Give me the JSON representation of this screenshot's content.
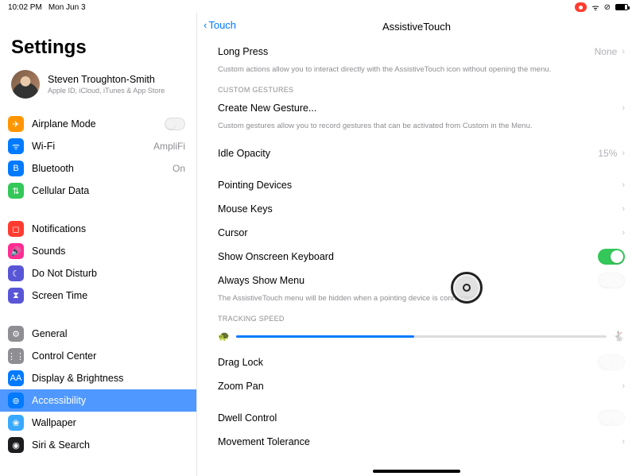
{
  "status": {
    "time": "10:02 PM",
    "date": "Mon Jun 3"
  },
  "sidebar": {
    "title": "Settings",
    "profile": {
      "name": "Steven Troughton-Smith",
      "sub": "Apple ID, iCloud, iTunes & App Store"
    },
    "groups": [
      [
        {
          "icon": "airplane-icon",
          "cls": "i-orange",
          "glyph": "✈",
          "label": "Airplane Mode",
          "trailing": "toggle"
        },
        {
          "icon": "wifi-icon",
          "cls": "i-blue",
          "glyph": "ᯤ",
          "label": "Wi-Fi",
          "trailing_text": "AmpliFi"
        },
        {
          "icon": "bluetooth-icon",
          "cls": "i-blue",
          "glyph": "B",
          "label": "Bluetooth",
          "trailing_text": "On"
        },
        {
          "icon": "cellular-icon",
          "cls": "i-green",
          "glyph": "⇅",
          "label": "Cellular Data"
        }
      ],
      [
        {
          "icon": "bell-icon",
          "cls": "i-red",
          "glyph": "◻",
          "label": "Notifications"
        },
        {
          "icon": "speaker-icon",
          "cls": "i-pink",
          "glyph": "🔊",
          "label": "Sounds"
        },
        {
          "icon": "moon-icon",
          "cls": "i-purple",
          "glyph": "☾",
          "label": "Do Not Disturb"
        },
        {
          "icon": "hourglass-icon",
          "cls": "i-indigo",
          "glyph": "⧗",
          "label": "Screen Time"
        }
      ],
      [
        {
          "icon": "gear-icon",
          "cls": "i-gray",
          "glyph": "⚙",
          "label": "General"
        },
        {
          "icon": "control-center-icon",
          "cls": "i-gray",
          "glyph": "⋮⋮",
          "label": "Control Center"
        },
        {
          "icon": "brightness-icon",
          "cls": "i-blue",
          "glyph": "AA",
          "label": "Display & Brightness"
        },
        {
          "icon": "accessibility-icon",
          "cls": "i-blue",
          "glyph": "⊚",
          "label": "Accessibility",
          "selected": true
        },
        {
          "icon": "wallpaper-icon",
          "cls": "i-skyblue",
          "glyph": "❀",
          "label": "Wallpaper"
        },
        {
          "icon": "siri-icon",
          "cls": "i-black",
          "glyph": "◉",
          "label": "Siri & Search"
        }
      ]
    ]
  },
  "detail": {
    "back": "Touch",
    "title": "AssistiveTouch",
    "long_press": {
      "label": "Long Press",
      "value": "None"
    },
    "long_press_footer": "Custom actions allow you to interact directly with the AssistiveTouch icon without opening the menu.",
    "custom_gestures_header": "CUSTOM GESTURES",
    "create_gesture": "Create New Gesture...",
    "custom_gestures_footer": "Custom gestures allow you to record gestures that can be activated from Custom in the Menu.",
    "idle_opacity": {
      "label": "Idle Opacity",
      "value": "15%"
    },
    "pointing": "Pointing Devices",
    "mouse_keys": "Mouse Keys",
    "cursor": "Cursor",
    "show_kb": "Show Onscreen Keyboard",
    "always_menu": "Always Show Menu",
    "always_menu_footer": "The AssistiveTouch menu will be hidden when a pointing device is connected.",
    "tracking_header": "TRACKING SPEED",
    "drag_lock": "Drag Lock",
    "zoom_pan": "Zoom Pan",
    "dwell": "Dwell Control",
    "movement_tol": "Movement Tolerance"
  }
}
